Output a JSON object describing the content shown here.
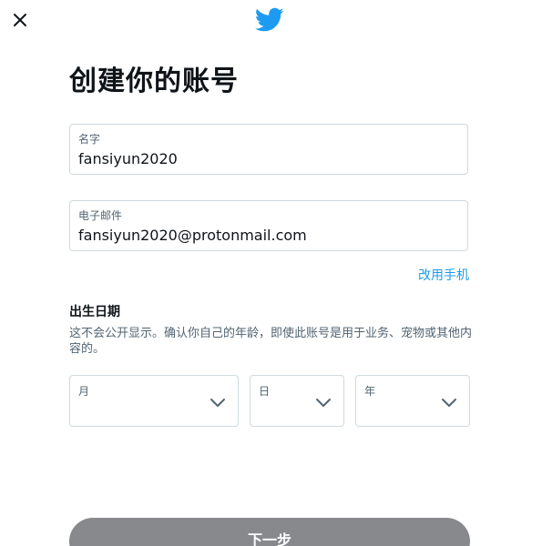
{
  "dialog": {
    "title": "创建你的账号",
    "brand_color": "#1d9bf0"
  },
  "icons": {
    "close": "close-icon",
    "logo": "twitter-bird-icon",
    "chevron": "chevron-down-icon"
  },
  "form": {
    "name": {
      "label": "名字",
      "value": "fansiyun2020"
    },
    "email": {
      "label": "电子邮件",
      "value": "fansiyun2020@protonmail.com"
    },
    "use_phone_link": "改用手机"
  },
  "dob": {
    "title": "出生日期",
    "description": "这不会公开显示。确认你自己的年龄，即使此账号是用于业务、宠物或其他内容的。",
    "month_label": "月",
    "day_label": "日",
    "year_label": "年"
  },
  "footer": {
    "next_label": "下一步",
    "next_bg": "#87898c"
  }
}
